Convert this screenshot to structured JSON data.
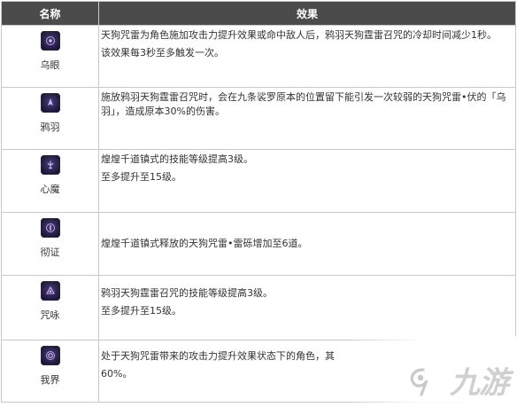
{
  "header": {
    "col_name": "名称",
    "col_effect": "效果"
  },
  "rows": [
    {
      "name": "乌眼",
      "icon": "eye-sigil-icon",
      "lines": [
        "天狗咒雷为角色施加攻击力提升效果或命中敌人后，鸦羽天狗霆雷召咒的冷却时间减少1秒。",
        "该效果每3秒至多触发一次。"
      ]
    },
    {
      "name": "鸦羽",
      "icon": "feather-sigil-icon",
      "lines": [
        "施放鸦羽天狗霆雷召咒时，会在九条裟罗原本的位置留下能引发一次较弱的天狗咒雷•伏的「乌羽」，造成原本30%的伤害。"
      ]
    },
    {
      "name": "心魔",
      "icon": "mind-sigil-icon",
      "lines": [
        "煌煌千道镇式的技能等级提高3级。",
        "至多提升至15级。"
      ]
    },
    {
      "name": "彻证",
      "icon": "proof-sigil-icon",
      "lines": [
        "煌煌千道镇式释放的天狗咒雷•雷砾增加至6道。"
      ]
    },
    {
      "name": "咒咏",
      "icon": "chant-sigil-icon",
      "lines": [
        "鸦羽天狗霆雷召咒的技能等级提高3级。",
        "至多提升至15级。"
      ]
    },
    {
      "name": "我界",
      "icon": "realm-sigil-icon",
      "lines": [
        "处于天狗咒雷带来的攻击力提升效果状态下的角色，其",
        "60%。"
      ]
    }
  ],
  "watermark": {
    "text": "九游",
    "icon": "9game-logo-icon"
  },
  "colors": {
    "header_bg": "#4b4b4b",
    "header_text": "#ffffff",
    "border": "#c9c9c9",
    "icon_bg": "#1e1838",
    "icon_fg": "#b9a6f0"
  }
}
